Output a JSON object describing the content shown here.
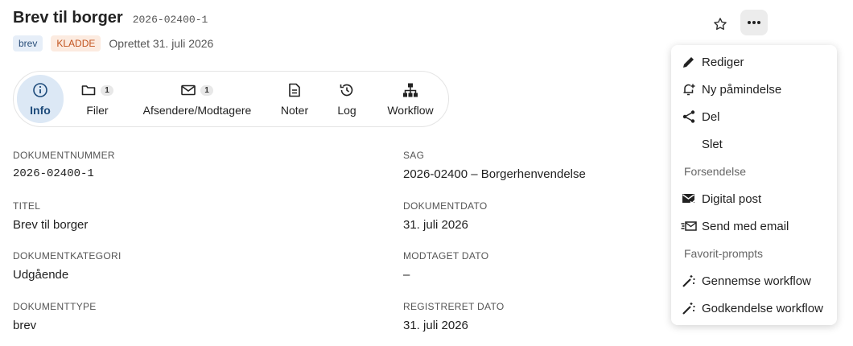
{
  "header": {
    "title": "Brev til borger",
    "code": "2026-02400-1",
    "type_badge": "brev",
    "status_badge": "KLADDE",
    "created": "Oprettet 31. juli 2026"
  },
  "tabs": [
    {
      "label": "Info",
      "icon": "info-icon"
    },
    {
      "label": "Filer",
      "icon": "folder-icon",
      "count": "1"
    },
    {
      "label": "Afsendere/Modtagere",
      "icon": "mail-icon",
      "count": "1"
    },
    {
      "label": "Noter",
      "icon": "note-icon"
    },
    {
      "label": "Log",
      "icon": "history-icon"
    },
    {
      "label": "Workflow",
      "icon": "workflow-icon"
    }
  ],
  "fields": {
    "dokumentnummer": {
      "label": "DOKUMENTNUMMER",
      "value": "2026-02400-1"
    },
    "sag": {
      "label": "SAG",
      "value": "2026-02400 – Borgerhenvendelse"
    },
    "titel": {
      "label": "TITEL",
      "value": "Brev til borger"
    },
    "dokumentdato": {
      "label": "DOKUMENTDATO",
      "value": "31. juli 2026"
    },
    "dokumentkategori": {
      "label": "DOKUMENTKATEGORI",
      "value": "Udgående"
    },
    "modtaget_dato": {
      "label": "MODTAGET DATO",
      "value": "–"
    },
    "dokumenttype": {
      "label": "DOKUMENTTYPE",
      "value": "brev"
    },
    "registreret_dato": {
      "label": "REGISTRERET DATO",
      "value": "31. juli 2026"
    }
  },
  "menu": {
    "rediger": "Rediger",
    "ny_paamindelse": "Ny påmindelse",
    "del": "Del",
    "slet": "Slet",
    "forsendelse_header": "Forsendelse",
    "digital_post": "Digital post",
    "send_email": "Send med email",
    "favorit_header": "Favorit-prompts",
    "gennemse_workflow": "Gennemse workflow",
    "godkendelse_workflow": "Godkendelse workflow"
  },
  "colors": {
    "accent": "#2a5d94",
    "active_tab_bg": "#dce8f5",
    "status_badge": "#c2541f"
  }
}
